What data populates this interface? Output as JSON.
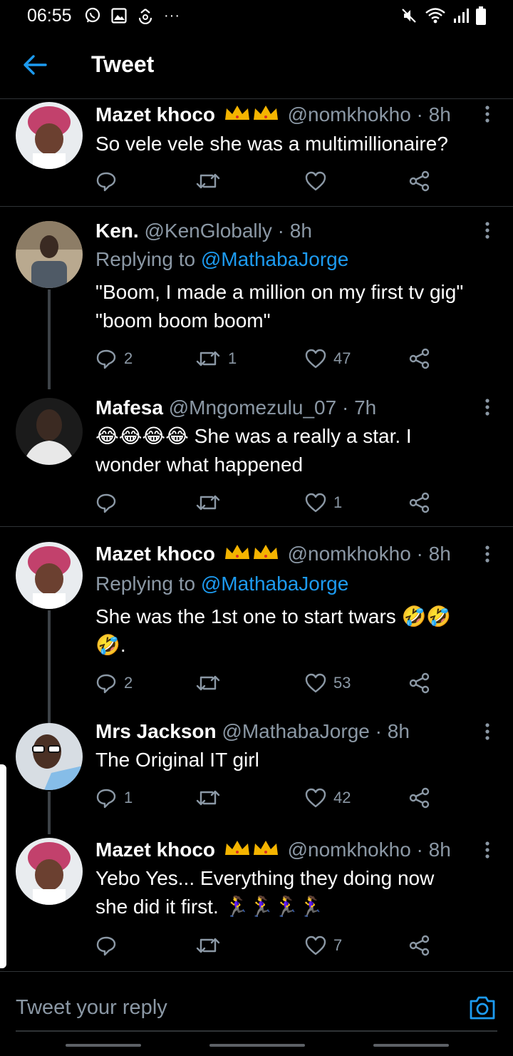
{
  "status_bar": {
    "time": "06:55",
    "more": "···",
    "left_icons": [
      "whatsapp-icon",
      "gallery-icon",
      "sync-icon"
    ],
    "right_icons": [
      "mute-icon",
      "wifi-icon",
      "signal-icon",
      "battery-icon"
    ]
  },
  "header": {
    "title": "Tweet"
  },
  "tweets": [
    {
      "name": "Mazet khoco",
      "handle": "@nomkhokho",
      "time": "8h",
      "replying_to": "",
      "text": "So vele vele she was a multimillionaire?",
      "replies": "",
      "retweets": "",
      "likes": ""
    },
    {
      "name": "Ken.",
      "handle": "@KenGlobally",
      "time": "8h",
      "replying_prefix": "Replying to",
      "replying_to": "@MathabaJorge",
      "text_lines": [
        "\"Boom, I made a million on my first tv gig\"",
        "\"boom boom boom\""
      ],
      "replies": "2",
      "retweets": "1",
      "likes": "47"
    },
    {
      "name": "Mafesa",
      "handle": "@Mngomezulu_07",
      "time": "7h",
      "emoji": "😂😂😂😂",
      "text_lines": [
        "She was a really a star. I",
        "wonder what happened"
      ],
      "replies": "",
      "retweets": "",
      "likes": "1"
    },
    {
      "name": "Mazet khoco",
      "handle": "@nomkhokho",
      "time": "8h",
      "replying_prefix": "Replying to",
      "replying_to": "@MathabaJorge",
      "text": "She was the 1st one to start twars",
      "emoji_line1": "🤣🤣",
      "emoji_line2": "🤣.",
      "replies": "2",
      "retweets": "",
      "likes": "53"
    },
    {
      "name": "Mrs Jackson",
      "handle": "@MathabaJorge",
      "time": "8h",
      "text": "The Original IT girl",
      "replies": "1",
      "retweets": "",
      "likes": "42"
    },
    {
      "name": "Mazet khoco",
      "handle": "@nomkhokho",
      "time": "8h",
      "text_lines": [
        "Yebo Yes... Everything they doing now",
        "she did it first."
      ],
      "emoji": "🏃‍♀️🏃‍♀️🏃‍♀️🏃‍♀️",
      "replies": "",
      "retweets": "",
      "likes": "7"
    }
  ],
  "composer": {
    "placeholder": "Tweet your reply"
  },
  "colors": {
    "background": "#000000",
    "link": "#1d9bf0",
    "muted": "#8b98a5",
    "divider": "#2f3336"
  }
}
